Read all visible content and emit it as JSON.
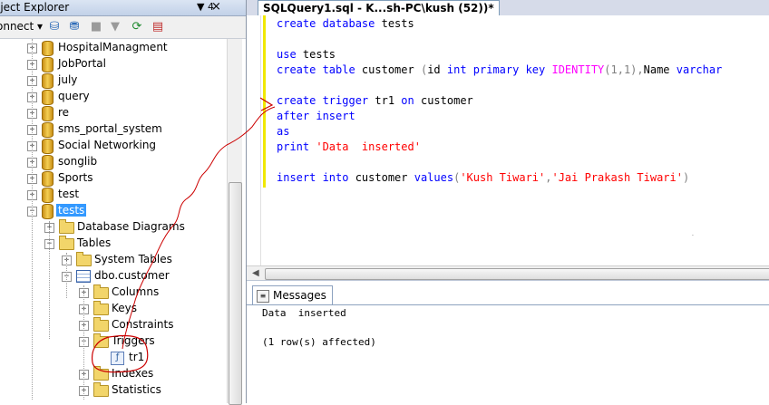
{
  "object_explorer": {
    "title": "oject Explorer",
    "connect_label": "onnect ▾",
    "pin_glyph": "▼ 4",
    "close_glyph": "×",
    "toolbar_icons": [
      "connect-db-icon",
      "disconnect-icon",
      "stop-icon",
      "filter-icon",
      "refresh-icon",
      "summary-icon"
    ],
    "tree": {
      "databases": [
        "HospitalManagment",
        "JobPortal",
        "july",
        "query",
        "re",
        "sms_portal_system",
        "Social Networking",
        "songlib",
        "Sports",
        "test"
      ],
      "selected_db": "tests",
      "db_children": [
        "Database Diagrams",
        "Tables"
      ],
      "table_children": [
        "System Tables"
      ],
      "table": "dbo.customer",
      "table_nodes": [
        "Columns",
        "Keys",
        "Constraints",
        "Triggers"
      ],
      "trigger_item": "tr1",
      "after_nodes": [
        "Indexes",
        "Statistics"
      ]
    }
  },
  "editor": {
    "tab_title": "SQLQuery1.sql - K...sh-PC\\kush (52))*",
    "code_lines": [
      [
        {
          "t": "create database ",
          "c": "kw"
        },
        {
          "t": "tests",
          "c": ""
        }
      ],
      [],
      [
        {
          "t": "use ",
          "c": "kw"
        },
        {
          "t": "tests",
          "c": ""
        }
      ],
      [
        {
          "t": "create table ",
          "c": "kw"
        },
        {
          "t": "customer ",
          "c": ""
        },
        {
          "t": "(",
          "c": "gr"
        },
        {
          "t": "id ",
          "c": ""
        },
        {
          "t": "int primary key ",
          "c": "kw"
        },
        {
          "t": "IDENTITY",
          "c": "fn"
        },
        {
          "t": "(1,1),",
          "c": "gr"
        },
        {
          "t": "Name ",
          "c": ""
        },
        {
          "t": "varchar",
          "c": "kw"
        }
      ],
      [],
      [
        {
          "t": "create trigger ",
          "c": "kw"
        },
        {
          "t": "tr1 ",
          "c": ""
        },
        {
          "t": "on ",
          "c": "kw"
        },
        {
          "t": "customer",
          "c": ""
        }
      ],
      [
        {
          "t": "after insert",
          "c": "kw"
        }
      ],
      [
        {
          "t": "as",
          "c": "kw"
        }
      ],
      [
        {
          "t": "print ",
          "c": "kw"
        },
        {
          "t": "'Data  inserted'",
          "c": "str"
        }
      ],
      [],
      [
        {
          "t": "insert into ",
          "c": "kw"
        },
        {
          "t": "customer ",
          "c": ""
        },
        {
          "t": "values",
          "c": "kw"
        },
        {
          "t": "(",
          "c": "gr"
        },
        {
          "t": "'Kush Tiwari'",
          "c": "str"
        },
        {
          "t": ",",
          "c": "gr"
        },
        {
          "t": "'Jai Prakash Tiwari'",
          "c": "str"
        },
        {
          "t": ")",
          "c": "gr"
        }
      ]
    ]
  },
  "results": {
    "tab_label": "Messages",
    "lines": [
      "Data  inserted",
      "",
      "(1 row(s) affected)"
    ]
  },
  "colors": {
    "keyword": "#0000ff",
    "string": "#ff0000",
    "function": "#ff00ff",
    "operator": "#808080",
    "selection": "#3399ff",
    "annotation": "#cc0000"
  }
}
